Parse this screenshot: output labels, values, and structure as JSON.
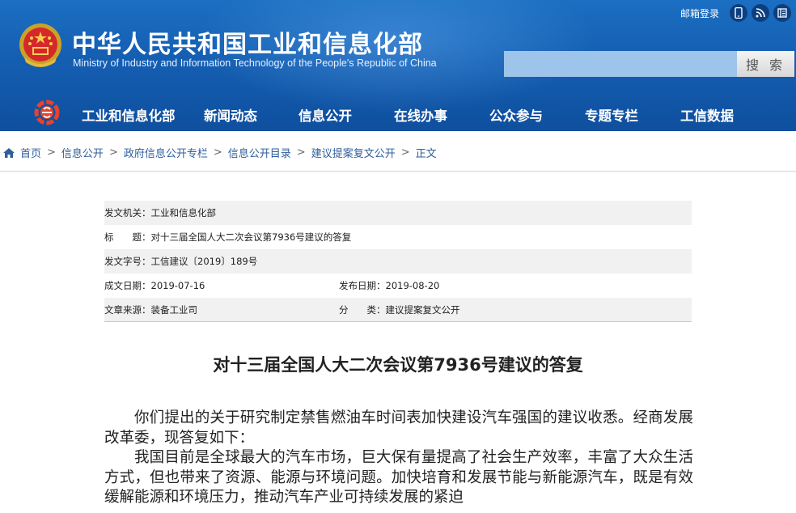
{
  "header": {
    "title_cn": "中华人民共和国工业和信息化部",
    "title_en": "Ministry of Industry and Information Technology of the People's Republic of China",
    "mail_login": "邮箱登录",
    "search_placeholder": "",
    "search_button": "搜 索",
    "icons": [
      "mobile-icon",
      "rss-icon",
      "weibo-icon"
    ]
  },
  "nav": {
    "items": [
      "工业和信息化部",
      "新闻动态",
      "信息公开",
      "在线办事",
      "公众参与",
      "专题专栏",
      "工信数据"
    ]
  },
  "breadcrumb": {
    "items": [
      "首页",
      "信息公开",
      "政府信息公开专栏",
      "信息公开目录",
      "建议提案复文公开"
    ],
    "current": "正文",
    "separator": ">"
  },
  "meta": {
    "issuer": "发文机关：工业和信息化部",
    "title": "标　　题：对十三届全国人大二次会议第7936号建议的答复",
    "doc_number": "发文字号：工信建议〔2019〕189号",
    "created_date": "成文日期：2019-07-16",
    "published_date": "发布日期：2019-08-20",
    "source": "文章来源：装备工业司",
    "category": "分　　类：建议提案复文公开"
  },
  "article": {
    "title": "对十三届全国人大二次会议第7936号建议的答复",
    "paragraphs": [
      "你们提出的关于研究制定禁售燃油车时间表加快建设汽车强国的建议收悉。经商发展改革委，现答复如下：",
      "我国目前是全球最大的汽车市场，巨大保有量提高了社会生产效率，丰富了大众生活方式，但也带来了资源、能源与环境问题。加快培育和发展节能与新能源汽车，既是有效缓解能源和环境压力，推动汽车产业可持续发展的紧迫"
    ]
  },
  "colors": {
    "header_blue": "#1560b4",
    "link_blue": "#2f5e9b"
  }
}
